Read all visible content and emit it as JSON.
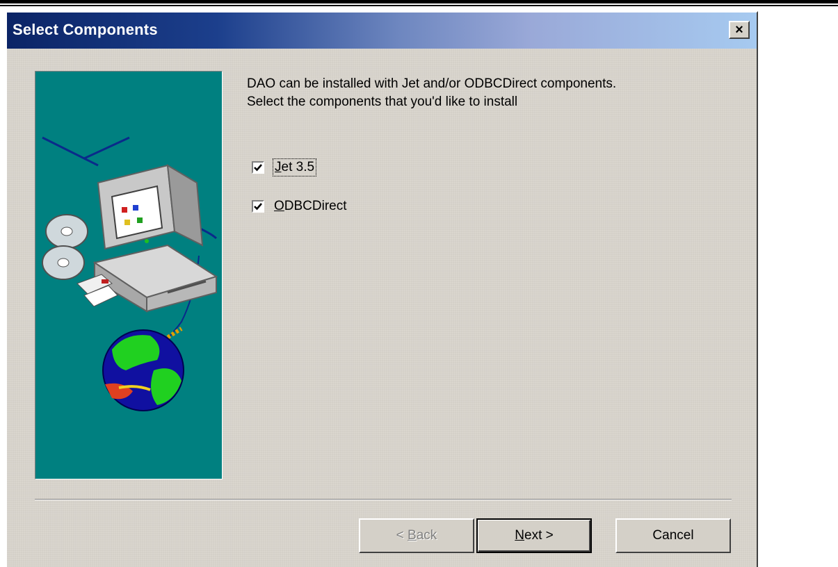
{
  "dialog": {
    "title": "Select Components",
    "close_glyph": "×",
    "instruction_line1": "DAO can be installed with Jet and/or ODBCDirect components.",
    "instruction_line2": "Select the components that you'd like to install"
  },
  "components": [
    {
      "mnemonic": "J",
      "label_rest": "et 3.5",
      "checked": true,
      "focused": true
    },
    {
      "mnemonic": "O",
      "label_rest": "DBCDirect",
      "checked": true,
      "focused": false
    }
  ],
  "buttons": {
    "back_prefix": "< ",
    "back_mnemonic": "B",
    "back_rest": "ack",
    "next_mnemonic": "N",
    "next_rest": "ext >",
    "cancel": "Cancel"
  },
  "icons": {
    "close": "close-icon",
    "check": "checkmark-icon",
    "illustration": "computer-globe-illustration"
  },
  "colors": {
    "title_bar_start": "#0b2466",
    "title_bar_end": "#a6caf0",
    "dialog_face": "#d4d0c8",
    "illustration_bg": "#008080"
  }
}
